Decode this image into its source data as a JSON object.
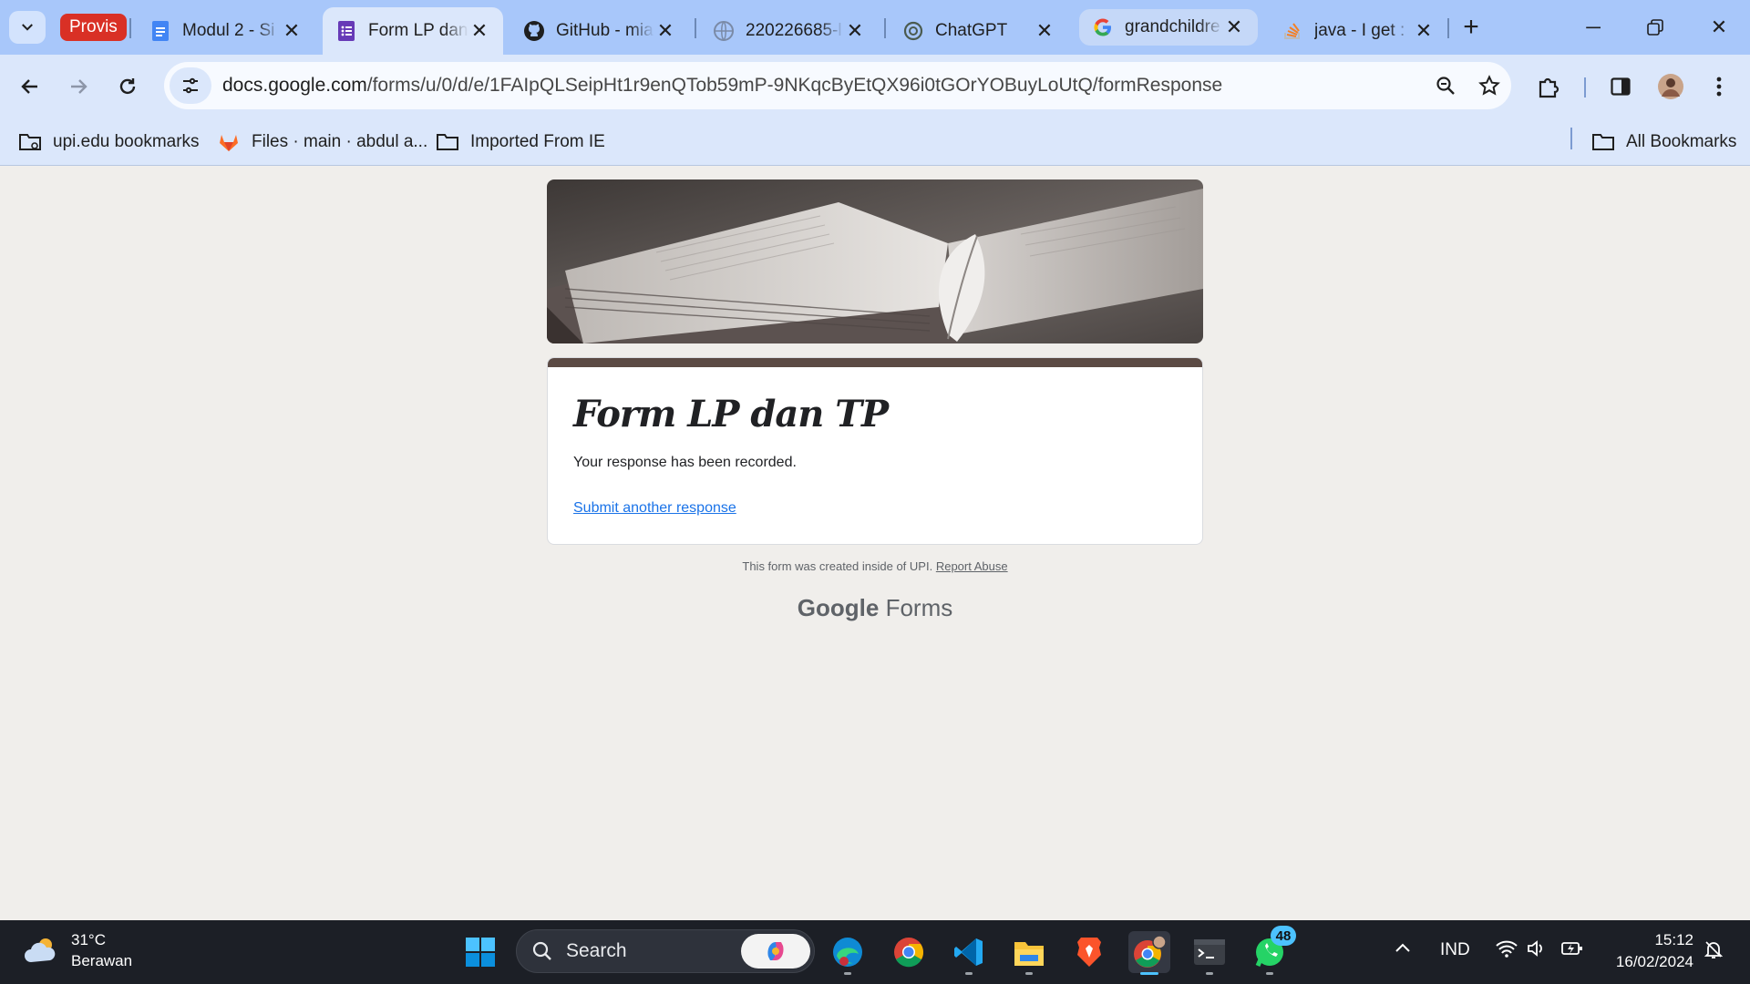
{
  "browser": {
    "tab_group_label": "Provis",
    "tabs": [
      {
        "title": "Modul 2 - Si",
        "icon": "docs-icon"
      },
      {
        "title": "Form LP dan",
        "icon": "forms-icon",
        "active": true
      },
      {
        "title": "GitHub - mia",
        "icon": "github-icon"
      },
      {
        "title": "220226685-l",
        "icon": "globe-icon"
      },
      {
        "title": "ChatGPT",
        "icon": "chatgpt-icon"
      },
      {
        "title": "grandchildre",
        "icon": "google-icon"
      },
      {
        "title": "java - I get :",
        "icon": "stackoverflow-icon"
      }
    ],
    "url_host": "docs.google.com",
    "url_path": "/forms/u/0/d/e/1FAIpQLSeipHt1r9enQTob59mP-9NKqcByEtQX96i0tGOrYOBuyLoUtQ/formResponse",
    "bookmarks": [
      {
        "label": "upi.edu bookmarks",
        "icon": "managed-folder-icon"
      },
      {
        "label": "Files · main · abdul a...",
        "icon": "gitlab-icon"
      },
      {
        "label": "Imported From IE",
        "icon": "folder-icon"
      }
    ],
    "all_bookmarks_label": "All Bookmarks"
  },
  "form": {
    "title": "Form LP dan TP",
    "message": "Your response has been recorded.",
    "link": "Submit another response",
    "footer_note": "This form was created inside of UPI.",
    "report_link": "Report Abuse",
    "brand_google": "Google",
    "brand_forms": "Forms",
    "accent_color": "#5b4a44",
    "page_bg": "#f0eeeb"
  },
  "taskbar": {
    "temperature": "31°C",
    "weather": "Berawan",
    "search_label": "Search",
    "whatsapp_badge": "48",
    "language": "IND",
    "time": "15:12",
    "date": "16/02/2024",
    "bg_color": "#1c1f26"
  }
}
